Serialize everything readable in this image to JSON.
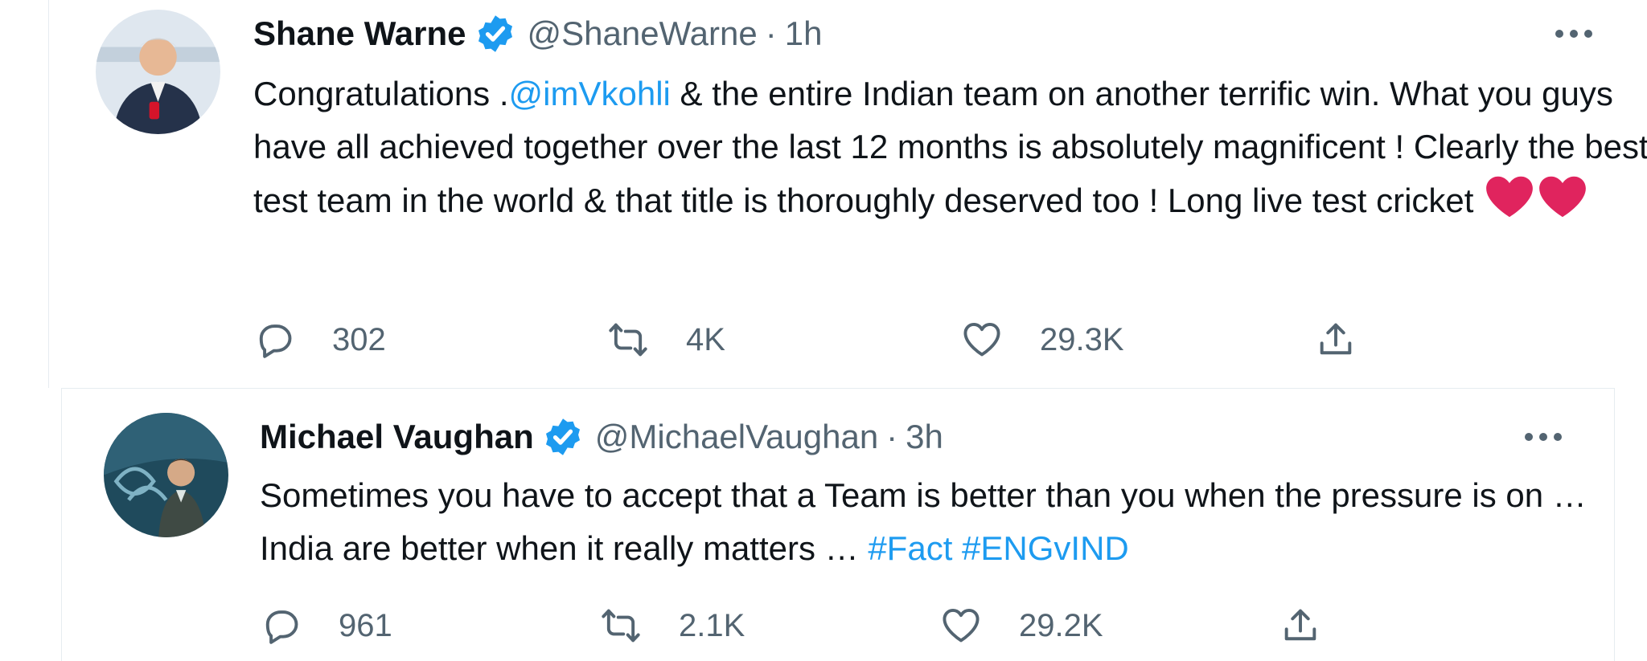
{
  "tweets": [
    {
      "author_name": "Shane Warne",
      "handle": "@ShaneWarne",
      "separator": "·",
      "time": "1h",
      "text_before": "Congratulations .",
      "mention": "@imVkohli",
      "text_after": " & the entire Indian team on another terrific win. What you guys have all achieved together over the last 12 months is absolutely magnificent ! Clearly the best test team in the world & that title is thoroughly deserved too ! Long live test cricket ",
      "replies": "302",
      "retweets": "4K",
      "likes": "29.3K"
    },
    {
      "author_name": "Michael Vaughan",
      "handle": "@MichaelVaughan",
      "separator": "·",
      "time": "3h",
      "text": "Sometimes you have to accept that a Team is better than you when the pressure is on … India are better when it really matters … ",
      "hashtags": [
        "#Fact",
        "#ENGvIND"
      ],
      "replies": "961",
      "retweets": "2.1K",
      "likes": "29.2K"
    }
  ],
  "colors": {
    "link": "#1d9bf0",
    "verified": "#1d9bf0",
    "heart_emoji": "#e0245e",
    "muted_text": "#536471",
    "primary_text": "#0f1419"
  },
  "icons": {
    "verified": "verified-badge-icon",
    "more": "more-options-icon",
    "reply": "reply-icon",
    "retweet": "retweet-icon",
    "like": "heart-outline-icon",
    "share": "share-icon",
    "emoji": "red-heart-emoji"
  }
}
